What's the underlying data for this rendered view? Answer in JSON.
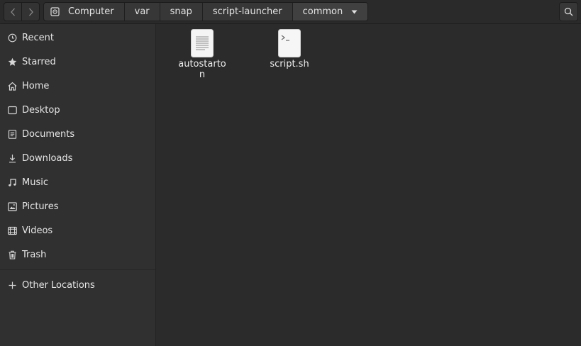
{
  "header": {
    "back_icon": "chevron-left-icon",
    "forward_icon": "chevron-right-icon",
    "breadcrumbs": [
      "Computer",
      "var",
      "snap",
      "script-launcher",
      "common"
    ],
    "search_icon": "search-icon"
  },
  "sidebar": {
    "items": [
      {
        "label": "Recent",
        "icon": "clock-icon"
      },
      {
        "label": "Starred",
        "icon": "star-icon"
      },
      {
        "label": "Home",
        "icon": "home-icon"
      },
      {
        "label": "Desktop",
        "icon": "desktop-icon"
      },
      {
        "label": "Documents",
        "icon": "document-icon"
      },
      {
        "label": "Downloads",
        "icon": "download-icon"
      },
      {
        "label": "Music",
        "icon": "music-icon"
      },
      {
        "label": "Pictures",
        "icon": "picture-icon"
      },
      {
        "label": "Videos",
        "icon": "video-icon"
      },
      {
        "label": "Trash",
        "icon": "trash-icon"
      }
    ],
    "other_locations": {
      "label": "Other Locations",
      "icon": "plus-icon"
    }
  },
  "files": [
    {
      "name": "autostarton",
      "icon": "text-file-icon"
    },
    {
      "name": "script.sh",
      "icon": "terminal-script-icon"
    }
  ],
  "colors": {
    "background": "#2c2c2c",
    "sidebar": "#303030",
    "text": "#e6e6e6"
  }
}
